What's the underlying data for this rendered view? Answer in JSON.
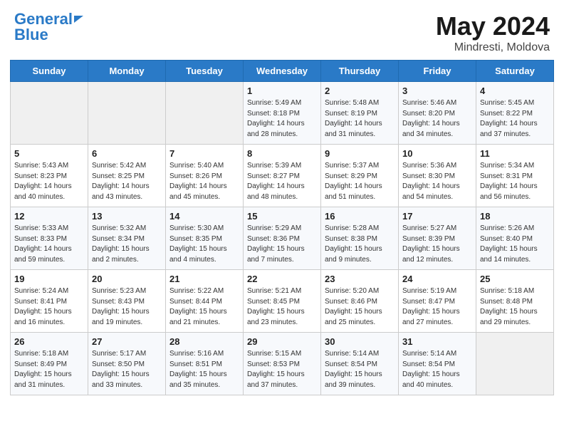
{
  "header": {
    "logo_line1": "General",
    "logo_line2": "Blue",
    "month": "May 2024",
    "location": "Mindresti, Moldova"
  },
  "days_of_week": [
    "Sunday",
    "Monday",
    "Tuesday",
    "Wednesday",
    "Thursday",
    "Friday",
    "Saturday"
  ],
  "weeks": [
    [
      {
        "day": "",
        "info": ""
      },
      {
        "day": "",
        "info": ""
      },
      {
        "day": "",
        "info": ""
      },
      {
        "day": "1",
        "info": "Sunrise: 5:49 AM\nSunset: 8:18 PM\nDaylight: 14 hours\nand 28 minutes."
      },
      {
        "day": "2",
        "info": "Sunrise: 5:48 AM\nSunset: 8:19 PM\nDaylight: 14 hours\nand 31 minutes."
      },
      {
        "day": "3",
        "info": "Sunrise: 5:46 AM\nSunset: 8:20 PM\nDaylight: 14 hours\nand 34 minutes."
      },
      {
        "day": "4",
        "info": "Sunrise: 5:45 AM\nSunset: 8:22 PM\nDaylight: 14 hours\nand 37 minutes."
      }
    ],
    [
      {
        "day": "5",
        "info": "Sunrise: 5:43 AM\nSunset: 8:23 PM\nDaylight: 14 hours\nand 40 minutes."
      },
      {
        "day": "6",
        "info": "Sunrise: 5:42 AM\nSunset: 8:25 PM\nDaylight: 14 hours\nand 43 minutes."
      },
      {
        "day": "7",
        "info": "Sunrise: 5:40 AM\nSunset: 8:26 PM\nDaylight: 14 hours\nand 45 minutes."
      },
      {
        "day": "8",
        "info": "Sunrise: 5:39 AM\nSunset: 8:27 PM\nDaylight: 14 hours\nand 48 minutes."
      },
      {
        "day": "9",
        "info": "Sunrise: 5:37 AM\nSunset: 8:29 PM\nDaylight: 14 hours\nand 51 minutes."
      },
      {
        "day": "10",
        "info": "Sunrise: 5:36 AM\nSunset: 8:30 PM\nDaylight: 14 hours\nand 54 minutes."
      },
      {
        "day": "11",
        "info": "Sunrise: 5:34 AM\nSunset: 8:31 PM\nDaylight: 14 hours\nand 56 minutes."
      }
    ],
    [
      {
        "day": "12",
        "info": "Sunrise: 5:33 AM\nSunset: 8:33 PM\nDaylight: 14 hours\nand 59 minutes."
      },
      {
        "day": "13",
        "info": "Sunrise: 5:32 AM\nSunset: 8:34 PM\nDaylight: 15 hours\nand 2 minutes."
      },
      {
        "day": "14",
        "info": "Sunrise: 5:30 AM\nSunset: 8:35 PM\nDaylight: 15 hours\nand 4 minutes."
      },
      {
        "day": "15",
        "info": "Sunrise: 5:29 AM\nSunset: 8:36 PM\nDaylight: 15 hours\nand 7 minutes."
      },
      {
        "day": "16",
        "info": "Sunrise: 5:28 AM\nSunset: 8:38 PM\nDaylight: 15 hours\nand 9 minutes."
      },
      {
        "day": "17",
        "info": "Sunrise: 5:27 AM\nSunset: 8:39 PM\nDaylight: 15 hours\nand 12 minutes."
      },
      {
        "day": "18",
        "info": "Sunrise: 5:26 AM\nSunset: 8:40 PM\nDaylight: 15 hours\nand 14 minutes."
      }
    ],
    [
      {
        "day": "19",
        "info": "Sunrise: 5:24 AM\nSunset: 8:41 PM\nDaylight: 15 hours\nand 16 minutes."
      },
      {
        "day": "20",
        "info": "Sunrise: 5:23 AM\nSunset: 8:43 PM\nDaylight: 15 hours\nand 19 minutes."
      },
      {
        "day": "21",
        "info": "Sunrise: 5:22 AM\nSunset: 8:44 PM\nDaylight: 15 hours\nand 21 minutes."
      },
      {
        "day": "22",
        "info": "Sunrise: 5:21 AM\nSunset: 8:45 PM\nDaylight: 15 hours\nand 23 minutes."
      },
      {
        "day": "23",
        "info": "Sunrise: 5:20 AM\nSunset: 8:46 PM\nDaylight: 15 hours\nand 25 minutes."
      },
      {
        "day": "24",
        "info": "Sunrise: 5:19 AM\nSunset: 8:47 PM\nDaylight: 15 hours\nand 27 minutes."
      },
      {
        "day": "25",
        "info": "Sunrise: 5:18 AM\nSunset: 8:48 PM\nDaylight: 15 hours\nand 29 minutes."
      }
    ],
    [
      {
        "day": "26",
        "info": "Sunrise: 5:18 AM\nSunset: 8:49 PM\nDaylight: 15 hours\nand 31 minutes."
      },
      {
        "day": "27",
        "info": "Sunrise: 5:17 AM\nSunset: 8:50 PM\nDaylight: 15 hours\nand 33 minutes."
      },
      {
        "day": "28",
        "info": "Sunrise: 5:16 AM\nSunset: 8:51 PM\nDaylight: 15 hours\nand 35 minutes."
      },
      {
        "day": "29",
        "info": "Sunrise: 5:15 AM\nSunset: 8:53 PM\nDaylight: 15 hours\nand 37 minutes."
      },
      {
        "day": "30",
        "info": "Sunrise: 5:14 AM\nSunset: 8:54 PM\nDaylight: 15 hours\nand 39 minutes."
      },
      {
        "day": "31",
        "info": "Sunrise: 5:14 AM\nSunset: 8:54 PM\nDaylight: 15 hours\nand 40 minutes."
      },
      {
        "day": "",
        "info": ""
      }
    ]
  ]
}
